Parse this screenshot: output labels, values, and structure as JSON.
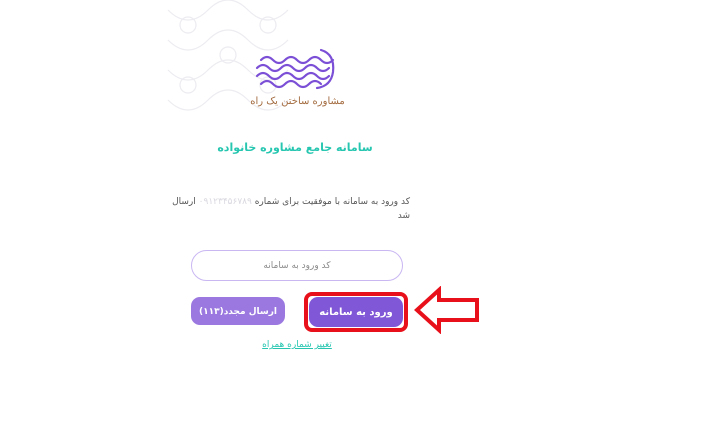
{
  "logo": {
    "caption": "مشاوره ساختن یک راه"
  },
  "title": "سامانه جامع مشاوره خانواده",
  "message": {
    "before": "کد ورود به سامانه با موفقیت برای شماره",
    "phone": "۰۹۱۲۳۴۵۶۷۸۹",
    "after": "ارسال شد"
  },
  "code_input": {
    "placeholder": "کد ورود به سامانه"
  },
  "buttons": {
    "login": "ورود به سامانه",
    "resend": "ارسال مجدد(۱۱۳)"
  },
  "change_number_link": "تغییر شماره همراه",
  "colors": {
    "accent": "#8057d6",
    "title": "#26c6b0",
    "highlight": "#e8101a"
  }
}
